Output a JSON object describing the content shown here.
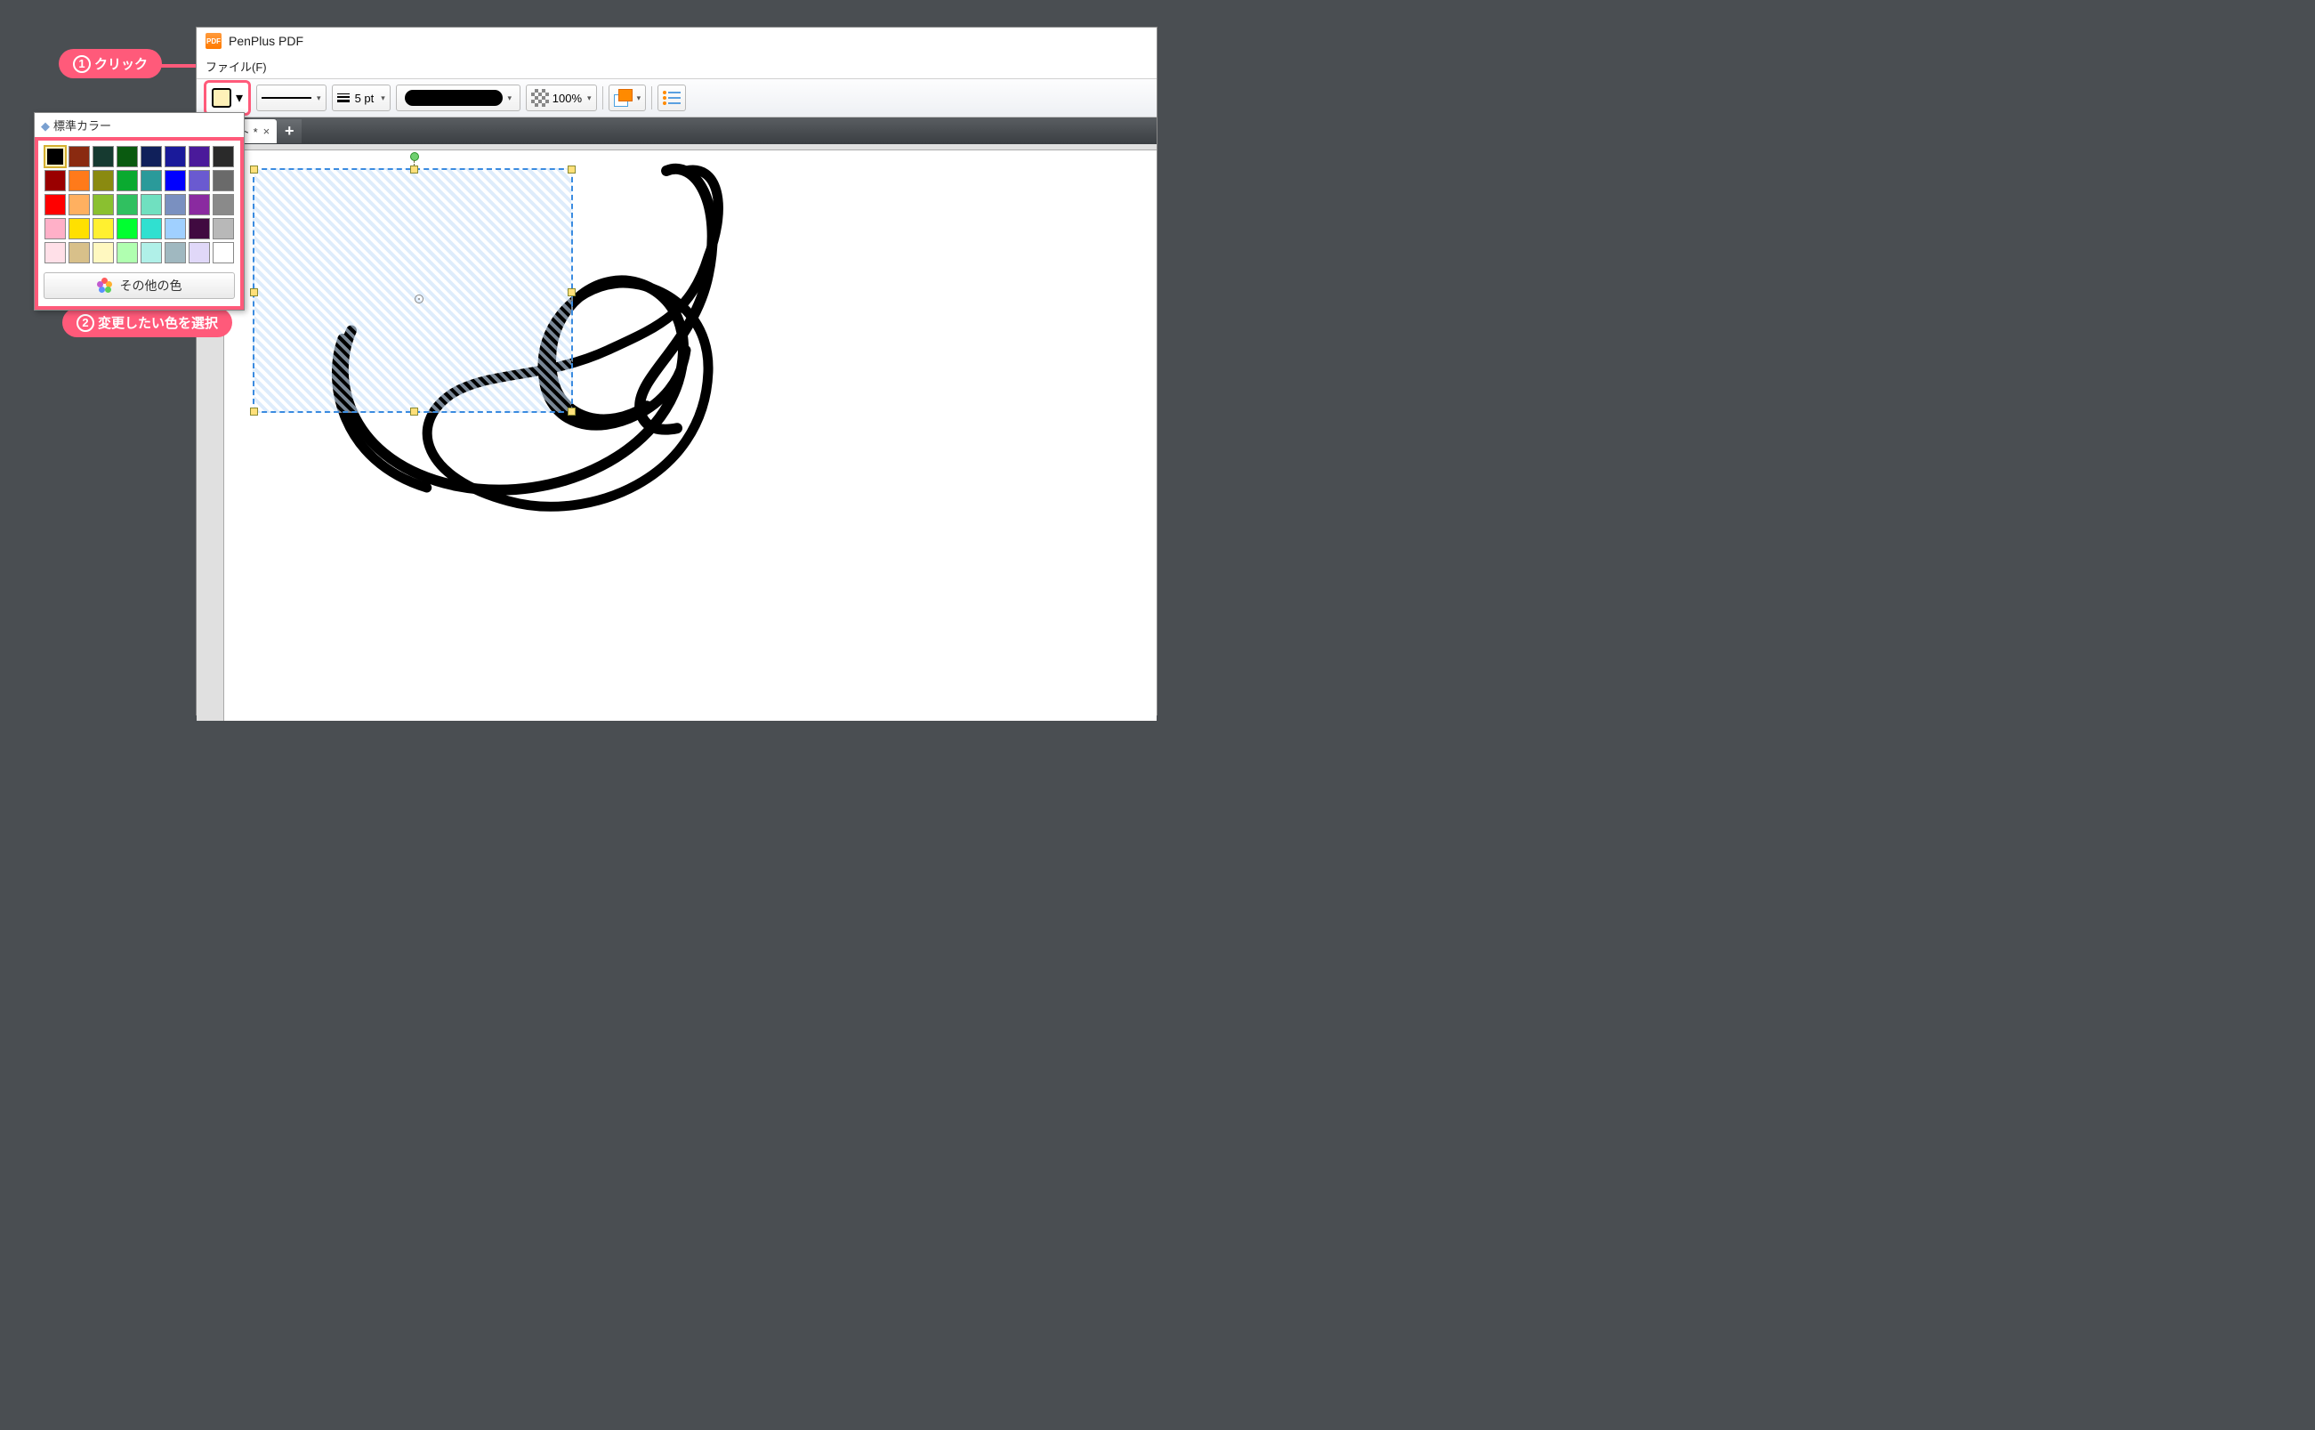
{
  "app": {
    "title": "PenPlus PDF",
    "menu_file": "ファイル(F)"
  },
  "toolbar": {
    "line_width_label": "5 pt",
    "opacity_label": "100%"
  },
  "tab": {
    "label": "ュメント *",
    "close": "×",
    "add": "+"
  },
  "palette": {
    "header": "標準カラー",
    "more_colors": "その他の色",
    "colors": [
      [
        "#000000",
        "#8a2a10",
        "#163a30",
        "#0a5a10",
        "#10205a",
        "#1a1a9a",
        "#4a1a9a",
        "#2a2a2a"
      ],
      [
        "#9a0000",
        "#ff7a1a",
        "#8a8a10",
        "#0aaa30",
        "#2a9a9a",
        "#0000ff",
        "#6a5ad0",
        "#6a6a6a"
      ],
      [
        "#ff0000",
        "#ffb060",
        "#8ac030",
        "#30c060",
        "#70e0c0",
        "#7a90c0",
        "#8a2aa0",
        "#8a8a8a"
      ],
      [
        "#ffb0c8",
        "#ffe000",
        "#fff030",
        "#00ff30",
        "#30e0d0",
        "#a0d0ff",
        "#400a40",
        "#b8b8b8"
      ],
      [
        "#ffe0e8",
        "#d8c08a",
        "#fff8c0",
        "#b0ffb0",
        "#b0f0e8",
        "#a0b8c0",
        "#e0d8f8",
        "#ffffff"
      ]
    ]
  },
  "callouts": {
    "c1_num": "1",
    "c1_text": "クリック",
    "c2_num": "2",
    "c2_text": "変更したい色を選択"
  }
}
